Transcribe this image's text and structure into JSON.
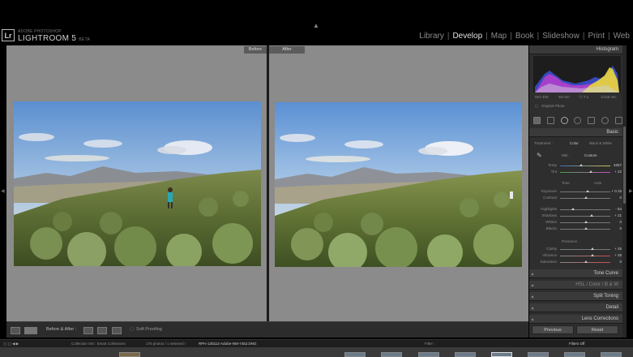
{
  "brand": {
    "logo": "Lr",
    "small": "ADOBE PHOTOSHOP",
    "name": "LIGHTROOM 5",
    "beta": "BETA"
  },
  "modules": [
    "Library",
    "Develop",
    "Map",
    "Book",
    "Slideshow",
    "Print",
    "Web"
  ],
  "active_module": "Develop",
  "view": {
    "before_label": "Before",
    "after_label": "After"
  },
  "toolbar": {
    "mode_label": "Before & After :",
    "soft_proofing": "Soft Proofing"
  },
  "right_panel": {
    "histogram_title": "Histogram",
    "hist_info": [
      "ISO 400",
      "28 mm",
      "f / 7.1",
      "1/125 sec"
    ],
    "original_photo": "Original Photo",
    "basic_title": "Basic",
    "treatment_label": "Treatment :",
    "treatment_color": "Color",
    "treatment_bw": "Black & White",
    "wb_label": "WB :",
    "wb_value": "Custom",
    "wb_sliders": [
      {
        "label": "Temp",
        "value": "4657"
      },
      {
        "label": "Tint",
        "value": "+ 22"
      }
    ],
    "tone_label": "Tone",
    "tone_auto": "Auto",
    "tone_sliders": [
      {
        "label": "Exposure",
        "value": "+ 0.15"
      },
      {
        "label": "Contrast",
        "value": "0"
      }
    ],
    "tone_sliders2": [
      {
        "label": "Highlights",
        "value": "- 54"
      },
      {
        "label": "Shadows",
        "value": "+ 21"
      },
      {
        "label": "Whites",
        "value": "0"
      },
      {
        "label": "Blacks",
        "value": "0"
      }
    ],
    "presence_label": "Presence",
    "presence_sliders": [
      {
        "label": "Clarity",
        "value": "+ 25"
      },
      {
        "label": "Vibrance",
        "value": "+ 25"
      },
      {
        "label": "Saturation",
        "value": "0"
      }
    ],
    "panels": [
      "Tone Curve",
      "HSL / Color / B & W",
      "Split Toning",
      "Detail",
      "Lens Corrections"
    ],
    "previous_button": "Previous",
    "reset_button": "Reset"
  },
  "filmstrip": {
    "collection": "Collection Set : Smart Collections",
    "count": "170 photos / 1 selected /",
    "filename": "RPH-130112-Adobe-NM-7452.DNG",
    "filter_label": "Filter :",
    "filter_value": "Filters Off"
  }
}
